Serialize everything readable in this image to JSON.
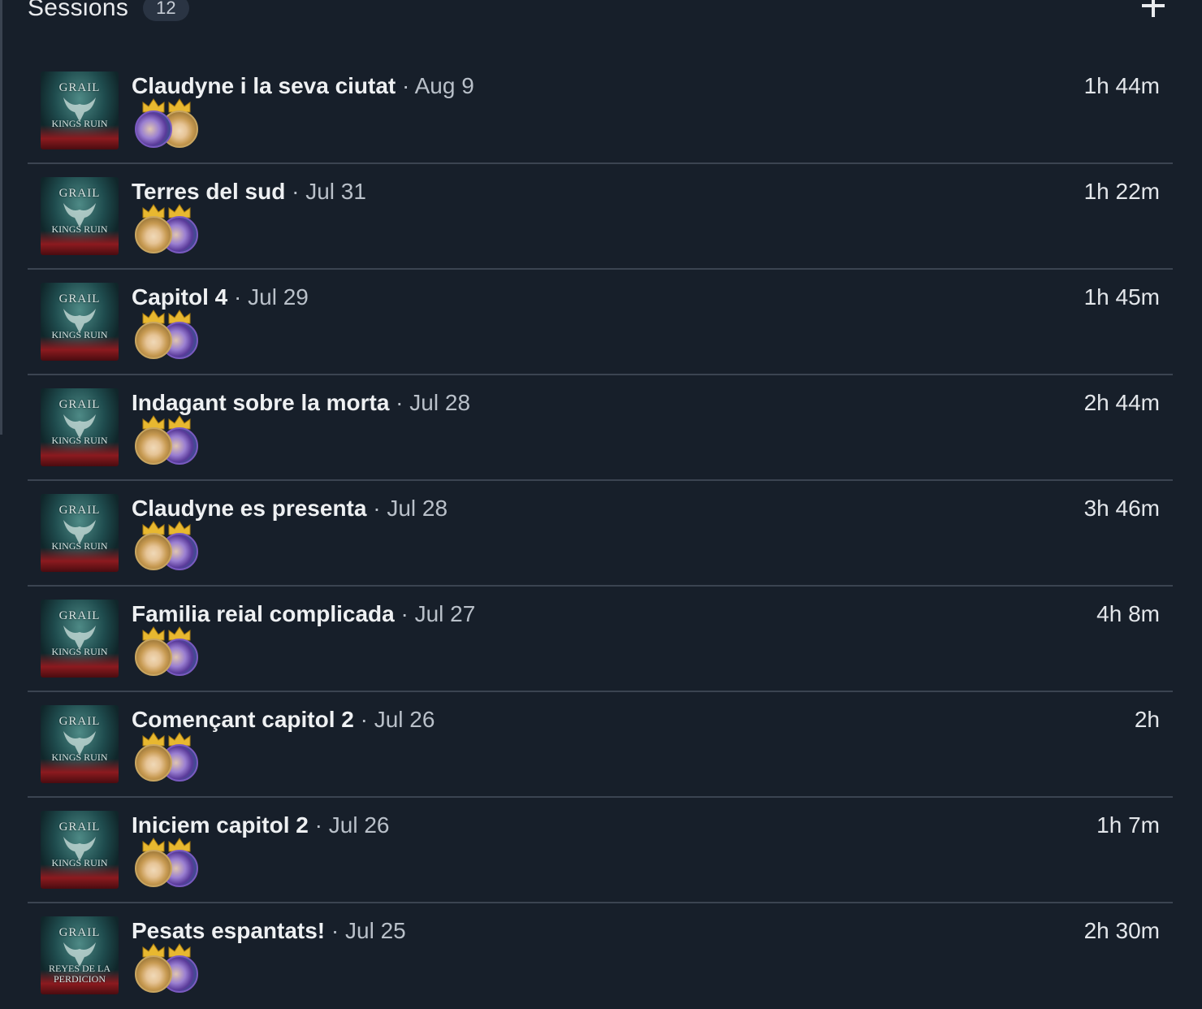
{
  "header": {
    "title": "Sessions",
    "count": "12",
    "add_icon": "plus-icon"
  },
  "cover_art": {
    "top_text": "GRAIL",
    "bottom_text_default": "KINGS RUIN",
    "bottom_text_alt": "REYES DE LA PERDICION"
  },
  "colors": {
    "background": "#171f2a",
    "divider": "#3b4451",
    "crown": "#e8b830",
    "badge_bg": "#2a3443"
  },
  "sessions": [
    {
      "title": "Claudyne i la seva ciutat",
      "date": "Aug 9",
      "duration": "1h 44m",
      "avatars": [
        "purple",
        "blonde"
      ]
    },
    {
      "title": "Terres del sud",
      "date": "Jul 31",
      "duration": "1h 22m",
      "avatars": [
        "blonde",
        "purple"
      ]
    },
    {
      "title": "Capitol 4",
      "date": "Jul 29",
      "duration": "1h 45m",
      "avatars": [
        "blonde",
        "purple"
      ]
    },
    {
      "title": "Indagant sobre la morta",
      "date": "Jul 28",
      "duration": "2h 44m",
      "avatars": [
        "blonde",
        "purple"
      ]
    },
    {
      "title": "Claudyne es presenta",
      "date": "Jul 28",
      "duration": "3h 46m",
      "avatars": [
        "blonde",
        "purple"
      ]
    },
    {
      "title": "Familia reial complicada",
      "date": "Jul 27",
      "duration": "4h 8m",
      "avatars": [
        "blonde",
        "purple"
      ]
    },
    {
      "title": "Començant capitol 2",
      "date": "Jul 26",
      "duration": "2h",
      "avatars": [
        "blonde",
        "purple"
      ]
    },
    {
      "title": "Iniciem capitol 2",
      "date": "Jul 26",
      "duration": "1h 7m",
      "avatars": [
        "blonde",
        "purple"
      ]
    },
    {
      "title": "Pesats espantats!",
      "date": "Jul 25",
      "duration": "2h 30m",
      "avatars": [
        "blonde",
        "purple"
      ],
      "alt_cover": true
    }
  ]
}
